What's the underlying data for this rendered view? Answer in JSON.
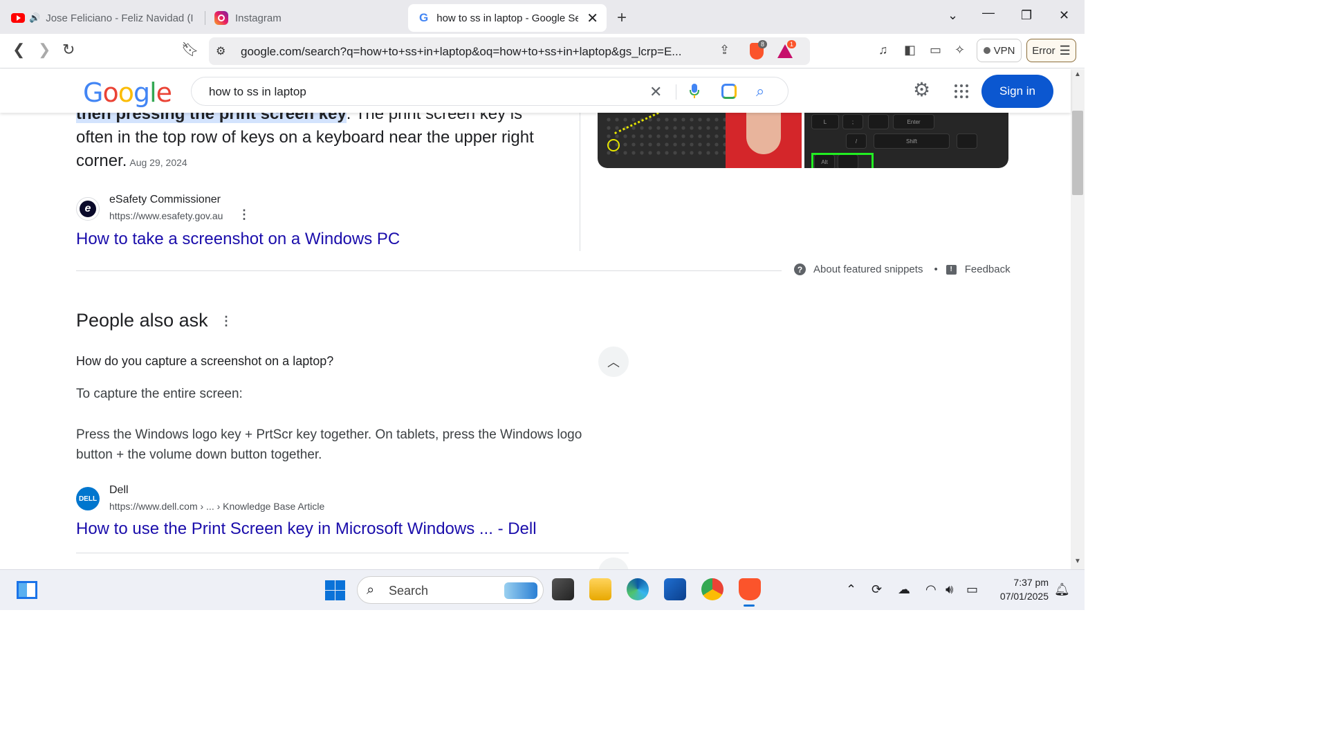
{
  "browser": {
    "tabs": [
      {
        "label": "Jose Feliciano - Feliz Navidad (I",
        "active": false,
        "audio": true
      },
      {
        "label": "Instagram",
        "active": false
      },
      {
        "label": "how to ss in laptop - Google Se",
        "active": true
      }
    ],
    "address": "google.com/search?q=how+to+ss+in+laptop&oq=how+to+ss+in+laptop&gs_lcrp=E...",
    "brave_shield_count": "8",
    "rewards_count": "1",
    "vpn_label": "VPN",
    "error_label": "Error"
  },
  "google": {
    "logo": [
      "G",
      "o",
      "o",
      "g",
      "l",
      "e"
    ],
    "query": "how to ss in laptop",
    "sign_in": "Sign in"
  },
  "snippet": {
    "highlight": "then pressing the print screen key",
    "text": ". The print screen key is often in the top row of keys on a keyboard near the upper right corner.",
    "date": "Aug 29, 2024",
    "source_name": "eSafety Commissioner",
    "source_url": "https://www.esafety.gov.au",
    "link_title": "How to take a screenshot on a Windows PC",
    "about_label": "About featured snippets",
    "feedback_label": "Feedback",
    "image_keys": [
      "L",
      ";",
      "Enter",
      "/",
      "Shift",
      "Alt"
    ]
  },
  "paa": {
    "title": "People also ask",
    "question": "How do you capture a screenshot on a laptop?",
    "answer_intro": "To capture the entire screen:",
    "answer_body": "Press the Windows logo key + PrtScr key together. On tablets, press the Windows logo button + the volume down button together.",
    "source_name": "Dell",
    "source_logo": "DELL",
    "source_url": "https://www.dell.com › ... › Knowledge Base Article",
    "link_title": "How to use the Print Screen key in Microsoft Windows ... - Dell"
  },
  "taskbar": {
    "search_placeholder": "Search",
    "time": "7:37 pm",
    "date": "07/01/2025"
  },
  "colors": {
    "link": "#1a0dab",
    "accent": "#0b57d0",
    "highlight": "#d3e3fd"
  }
}
